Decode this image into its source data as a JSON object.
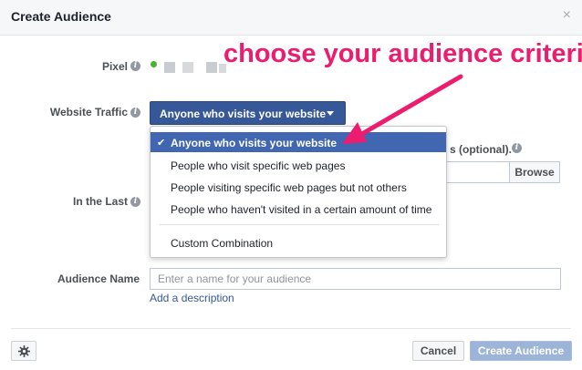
{
  "dialog": {
    "title": "Create Audience",
    "close_glyph": "×"
  },
  "pixel": {
    "label": "Pixel",
    "status_color": "#42b72a"
  },
  "website_traffic": {
    "label": "Website Traffic",
    "selected": "Anyone who visits your website",
    "options": [
      "Anyone who visits your website",
      "People who visit specific web pages",
      "People visiting specific web pages but not others",
      "People who haven't visited in a certain amount of time"
    ],
    "extra_option": "Custom Combination",
    "selected_index": 0
  },
  "background_fields": {
    "optional_text": "s (optional).",
    "browse_label": "Browse",
    "in_the_last_label": "In the Last"
  },
  "audience_name": {
    "label": "Audience Name",
    "placeholder": "Enter a name for your audience",
    "value": "",
    "add_description": "Add a description"
  },
  "footer": {
    "cancel_label": "Cancel",
    "create_label": "Create Audience"
  },
  "annotation": {
    "text": "choose your audience criteria",
    "color": "#ec1c6e"
  },
  "icons": {
    "info": "info-icon",
    "gear": "gear-icon",
    "close": "close-icon",
    "check": "check-icon",
    "caret": "caret-down-icon"
  },
  "colors": {
    "primary_button": "#365899",
    "selected_item": "#4267b2",
    "disabled_create": "#9cb4d8",
    "link": "#365899"
  }
}
